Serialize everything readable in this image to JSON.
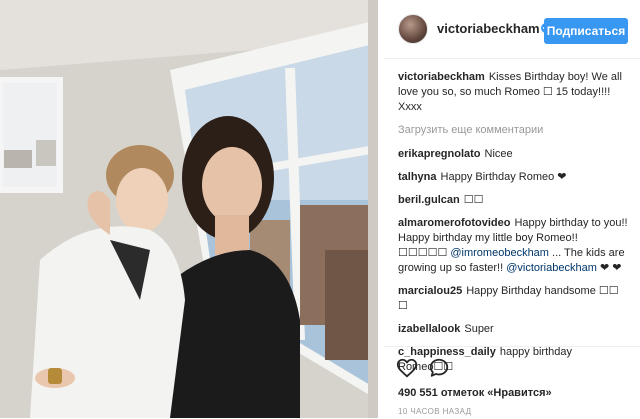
{
  "post": {
    "username": "victoriabeckham",
    "follow_label": "Подписаться",
    "caption_user": "victoriabeckham",
    "caption_text": "Kisses Birthday boy! We all love you so, so much Romeo ☐ 15 today!!!! Xxxx",
    "load_more": "Загрузить еще комментарии",
    "likes": "490 551 отметок «Нравится»",
    "time": "10 ЧАСОВ НАЗАД"
  },
  "comments": [
    {
      "user": "erikapregnolato",
      "text": "Nicee"
    },
    {
      "user": "talhyna",
      "text": "Happy Birthday Romeo ❤"
    },
    {
      "user": "beril.gulcan",
      "text": "☐☐"
    },
    {
      "user": "almaromerofotovideo",
      "text": "Happy birthday to you!! Happy birthday my little boy Romeo!! ☐☐☐☐☐",
      "mention1": "@imromeobeckham",
      "text2": " ... The kids are growing up so faster!! ",
      "mention2": "@victoriabeckham",
      "text3": " ❤ ❤"
    },
    {
      "user": "marcialou25",
      "text": "Happy Birthday handsome ☐☐ ☐"
    },
    {
      "user": "izabellalook",
      "text": "Super"
    },
    {
      "user": "c_happiness_daily",
      "text": "happy birthday Romeo☐☐"
    }
  ],
  "icons": {
    "verified": "verified-badge-icon",
    "like": "heart-icon",
    "comment": "comment-bubble-icon",
    "avatar": "profile-avatar"
  },
  "colors": {
    "accent": "#3897f0",
    "username": "#262626",
    "muted": "#999999",
    "mention": "#003569"
  }
}
